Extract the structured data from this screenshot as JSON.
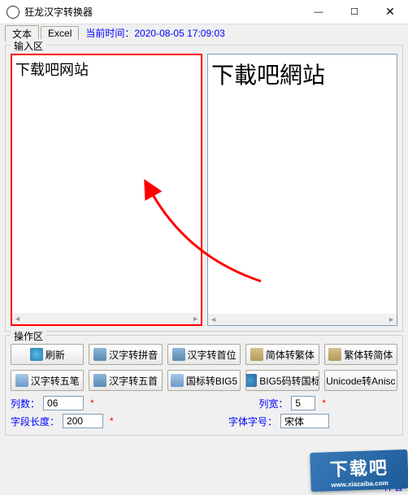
{
  "window": {
    "title": "狂龙汉字转换器",
    "minimize": "—",
    "maximize": "☐",
    "close": "✕"
  },
  "tabs": {
    "text": "文本",
    "excel": "Excel"
  },
  "time": {
    "label": "当前时间：",
    "value": "2020-08-05  17:09:03"
  },
  "input": {
    "legend": "输入区",
    "left_text": "下载吧网站",
    "right_text": "下載吧網站"
  },
  "ops": {
    "legend": "操作区",
    "row1": {
      "refresh": "刷新",
      "hz2py": "汉字转拼音",
      "hz2sw": "汉字转首位",
      "jt2ft": "简体转繁体",
      "ft2jt": "繁体转简体"
    },
    "row2": {
      "hz2wb": "汉字转五笔",
      "hz2ws": "汉字转五首",
      "gb2big5": "国标转BIG5",
      "big52gb": "BIG5码转国标",
      "uni2ansi": "Unicode转Anisc"
    },
    "cols_label": "列数：",
    "cols_value": "06",
    "width_label": "列宽：",
    "width_value": "5",
    "len_label": "字段长度：",
    "len_value": "200",
    "font_label": "字体字号：",
    "font_value": "宋体",
    "author_label": "作者"
  },
  "watermark": {
    "brand": "下载吧",
    "url": "www.xiazaiba.com"
  }
}
